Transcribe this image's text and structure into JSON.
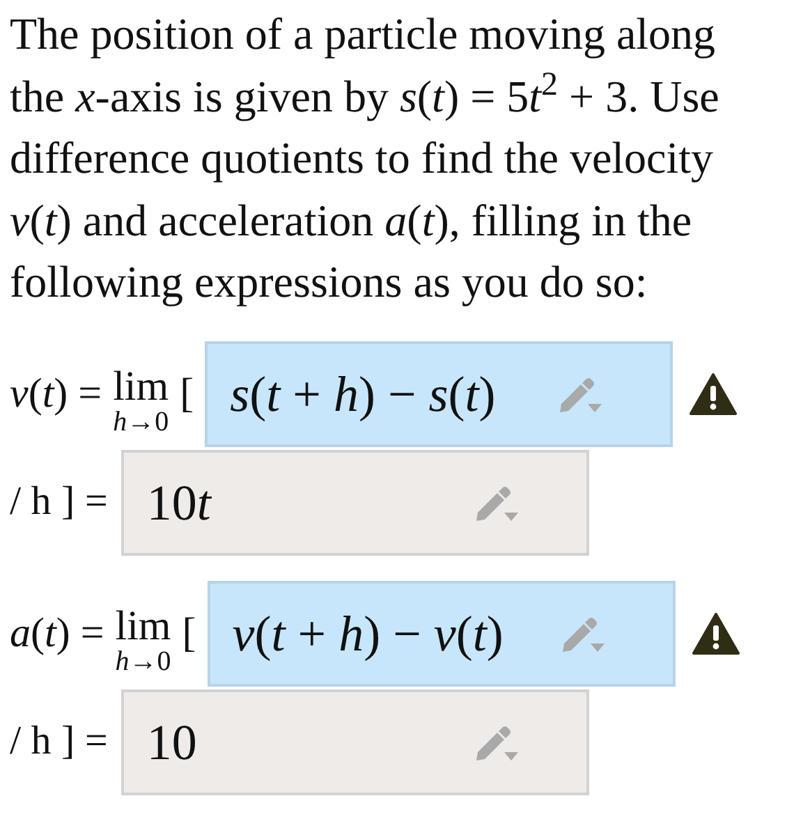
{
  "question": [
    "The position of a particle moving along the *x*-axis is given by *s*(*t*) = 5",
    "*t*$^{2}$ + 3. Use difference quotients to find the velocity *v*(*t*) and acceleration *a*(*t*), filling in the following expressions as you do so:"
  ],
  "parts": [
    {
      "lhs": "*v*(*t*) =",
      "lim": "lim",
      "lim_sub": "*h*→0",
      "open_bracket": "[",
      "numerator": {
        "value": [
          "*s*(*t* + *h*) − *s*(*t*)"
        ],
        "highlighted": true,
        "warning": true
      },
      "divide": "/ h ] =",
      "answer": {
        "value": [
          "10",
          "*t*"
        ],
        "highlighted": false
      }
    },
    {
      "lhs": "*a*(*t*) =",
      "lim": "lim",
      "lim_sub": "*h*→0",
      "open_bracket": "[",
      "numerator": {
        "value": [
          "*v*(*t* + *h*) − *v*(*t*)"
        ],
        "highlighted": true,
        "warning": true
      },
      "divide": "/ h ] =",
      "answer": {
        "value": [
          "10"
        ],
        "highlighted": false
      }
    }
  ]
}
